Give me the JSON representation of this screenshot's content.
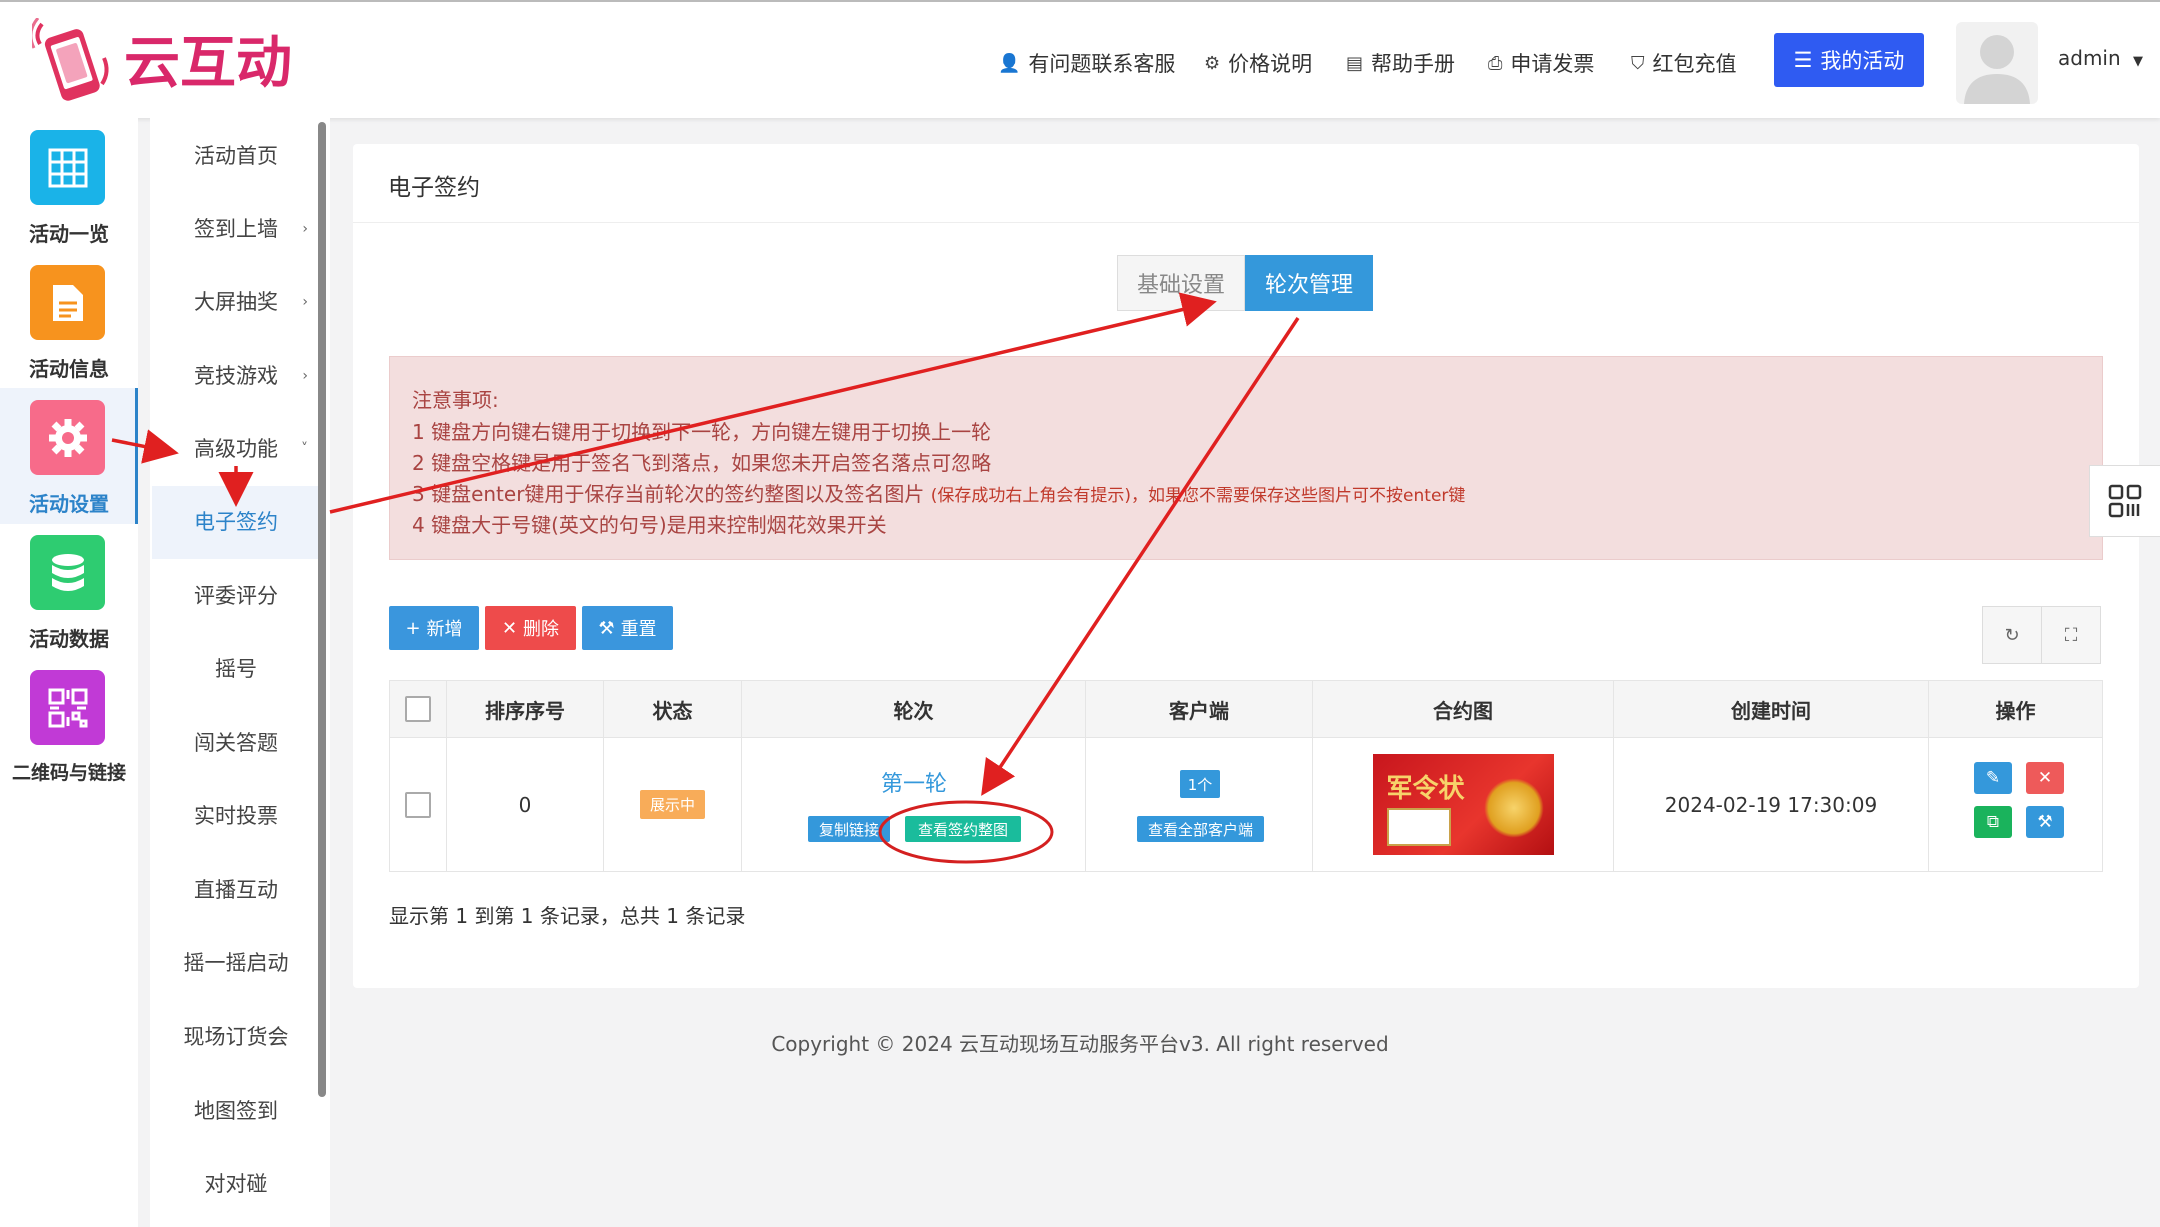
{
  "brand": {
    "name": "云互动"
  },
  "header": {
    "links": [
      {
        "label": "有问题联系客服",
        "icon": "user-plus-icon"
      },
      {
        "label": "价格说明",
        "icon": "gear-icon"
      },
      {
        "label": "帮助手册",
        "icon": "book-icon"
      },
      {
        "label": "申请发票",
        "icon": "printer-icon"
      },
      {
        "label": "红包充值",
        "icon": "shield-check-icon"
      }
    ],
    "primary_button": "我的活动",
    "user": "admin"
  },
  "rail": {
    "items": [
      {
        "label": "活动一览",
        "icon": "grid-icon",
        "color": "#1ab3e8"
      },
      {
        "label": "活动信息",
        "icon": "document-icon",
        "color": "#f7931e"
      },
      {
        "label": "活动设置",
        "icon": "gear-icon",
        "color": "#f76b8a",
        "active": true
      },
      {
        "label": "活动数据",
        "icon": "database-icon",
        "color": "#2ecc71"
      },
      {
        "label": "二维码与链接",
        "icon": "qrcode-icon",
        "color": "#c13ad6"
      }
    ]
  },
  "submenu": {
    "items": [
      {
        "label": "活动首页"
      },
      {
        "label": "签到上墙",
        "chevron": "›"
      },
      {
        "label": "大屏抽奖",
        "chevron": "›"
      },
      {
        "label": "竞技游戏",
        "chevron": "›"
      },
      {
        "label": "高级功能",
        "chevron": "˅"
      },
      {
        "label": "电子签约",
        "active": true
      },
      {
        "label": "评委评分"
      },
      {
        "label": "摇号"
      },
      {
        "label": "闯关答题"
      },
      {
        "label": "实时投票"
      },
      {
        "label": "直播互动"
      },
      {
        "label": "摇一摇启动"
      },
      {
        "label": "现场订货会"
      },
      {
        "label": "地图签到"
      },
      {
        "label": "对对碰"
      }
    ]
  },
  "panel": {
    "title": "电子签约",
    "tabs": [
      {
        "label": "基础设置"
      },
      {
        "label": "轮次管理",
        "active": true
      }
    ],
    "notice": {
      "title": "注意事项:",
      "lines": [
        "1 键盘方向键右键用于切换到下一轮，方向键左键用于切换上一轮",
        "2 键盘空格键是用于签名飞到落点，如果您未开启签名落点可忽略",
        "3 键盘enter键用于保存当前轮次的签约整图以及签名图片",
        "4 键盘大于号键(英文的句号)是用来控制烟花效果开关"
      ],
      "line3_small": "(保存成功右上角会有提示)，如果您不需要保存这些图片可不按enter键"
    },
    "toolbar": {
      "add": "新增",
      "delete": "删除",
      "reset": "重置"
    },
    "table": {
      "headers": [
        "排序序号",
        "状态",
        "轮次",
        "客户端",
        "合约图",
        "创建时间",
        "操作"
      ],
      "rows": [
        {
          "order": "0",
          "status": "展示中",
          "round": "第一轮",
          "copy_link": "复制链接",
          "view_image": "查看签约整图",
          "client_count": "1个",
          "view_clients": "查看全部客户端",
          "contract_image_text": "军令状",
          "created": "2024-02-19 17:30:09"
        }
      ]
    },
    "records": "显示第 1 到第 1 条记录，总共 1 条记录"
  },
  "footer": {
    "copyright": "Copyright © 2024 云互动现场互动服务平台v3. All right reserved"
  }
}
